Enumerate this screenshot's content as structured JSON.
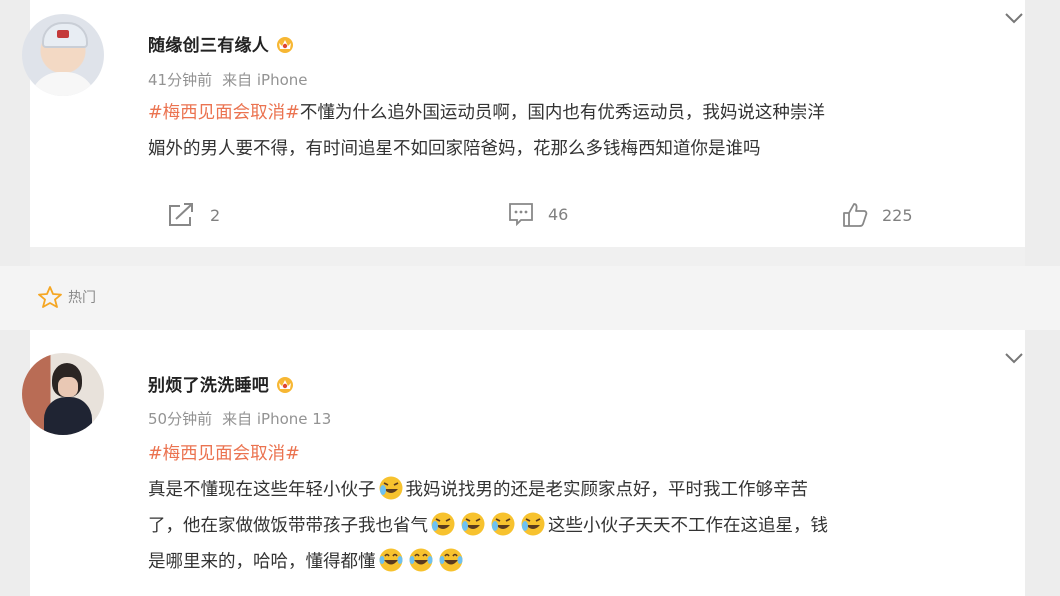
{
  "post": {
    "username": "随缘创三有缘人",
    "time": "41分钟前",
    "source": "来自 iPhone",
    "hashtag": "#梅西见面会取消#",
    "text_line1": "不懂为什么追外国运动员啊，国内也有优秀运动员，我妈说这种崇洋",
    "text_line2": "媚外的男人要不得，有时间追星不如回家陪爸妈，花那么多钱梅西知道你是谁吗",
    "repost_count": "2",
    "comment_count": "46",
    "like_count": "225"
  },
  "section": {
    "label": "热门"
  },
  "comment": {
    "username": "别烦了洗洗睡吧",
    "time": "50分钟前",
    "source": "来自 iPhone 13",
    "hashtag": "#梅西见面会取消#",
    "seg1": "真是不懂现在这些年轻小伙子",
    "seg2": "我妈说找男的还是老实顾家点好，平时我工作够辛苦",
    "seg3": "了，他在家做做饭带带孩子我也省气",
    "seg4": "这些小伙子天天不工作在这追星，钱",
    "seg5": "是哪里来的，哈哈，懂得都懂"
  },
  "icons": {
    "repost": "repost-icon",
    "comment": "comment-icon",
    "like": "like-icon",
    "star": "star-icon",
    "crown": "crown-icon",
    "cry_emoji": "cry-laugh-emoji",
    "laugh_emoji": "laugh-tears-emoji",
    "chevron": "chevron-down-icon"
  },
  "colors": {
    "hashtag": "#eb7350",
    "meta": "#939393",
    "star": "#f5a623"
  }
}
